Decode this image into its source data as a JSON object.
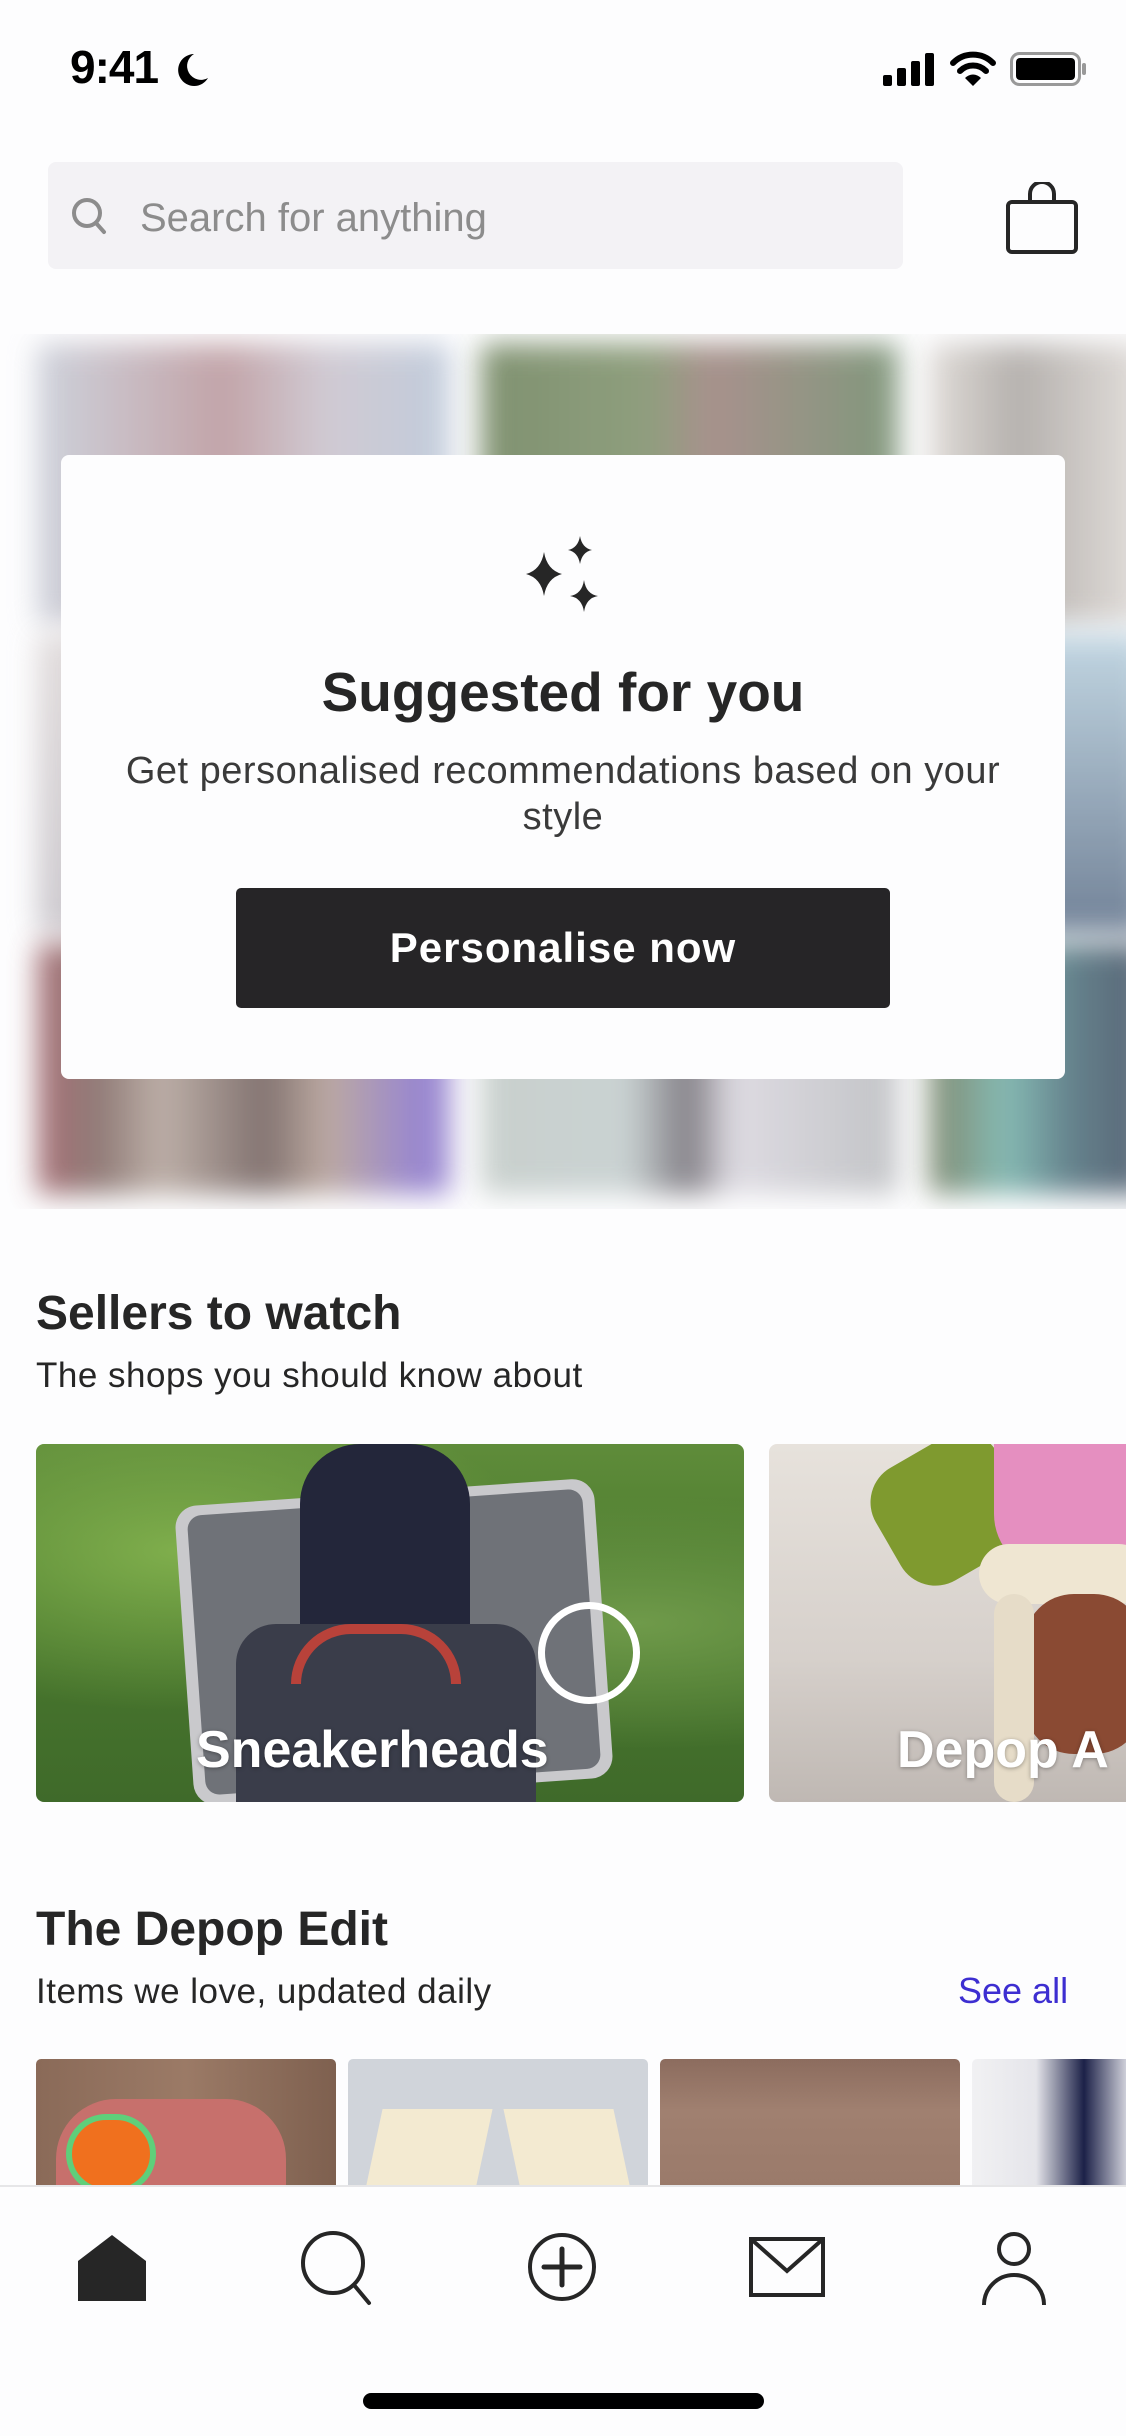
{
  "status_bar": {
    "time": "9:41",
    "icons": [
      "moon-icon",
      "signal-icon",
      "wifi-icon",
      "battery-icon"
    ]
  },
  "search": {
    "placeholder": "Search for anything",
    "value": "",
    "icon": "search-icon"
  },
  "header": {
    "bag_icon": "shopping-bag-icon"
  },
  "personalise_card": {
    "icon": "sparkle-icon",
    "title": "Suggested for you",
    "description": "Get personalised recommendations based on your style",
    "button_label": "Personalise now"
  },
  "sellers": {
    "title": "Sellers to watch",
    "subtitle": "The shops you should know about",
    "cards": [
      {
        "label": "Sneakerheads"
      },
      {
        "label": "Depop A"
      }
    ]
  },
  "depop_edit": {
    "title": "The Depop Edit",
    "subtitle": "Items we love, updated daily",
    "see_all_label": "See all",
    "accent_color": "#3d2ed1",
    "items": [
      {
        "name": "orange-sneaker"
      },
      {
        "name": "cream-trousers"
      },
      {
        "name": "brick-wall-item"
      },
      {
        "name": "navy-top"
      }
    ]
  },
  "bottom_nav": {
    "items": [
      {
        "name": "home",
        "icon": "home-icon",
        "active": true
      },
      {
        "name": "search",
        "icon": "search-icon",
        "active": false
      },
      {
        "name": "sell",
        "icon": "plus-circle-icon",
        "active": false
      },
      {
        "name": "inbox",
        "icon": "mail-icon",
        "active": false
      },
      {
        "name": "profile",
        "icon": "person-icon",
        "active": false
      }
    ]
  },
  "colors": {
    "primary_button": "#262527",
    "link": "#3d2ed1",
    "search_bg": "#f3f2f5",
    "text": "#262626"
  }
}
